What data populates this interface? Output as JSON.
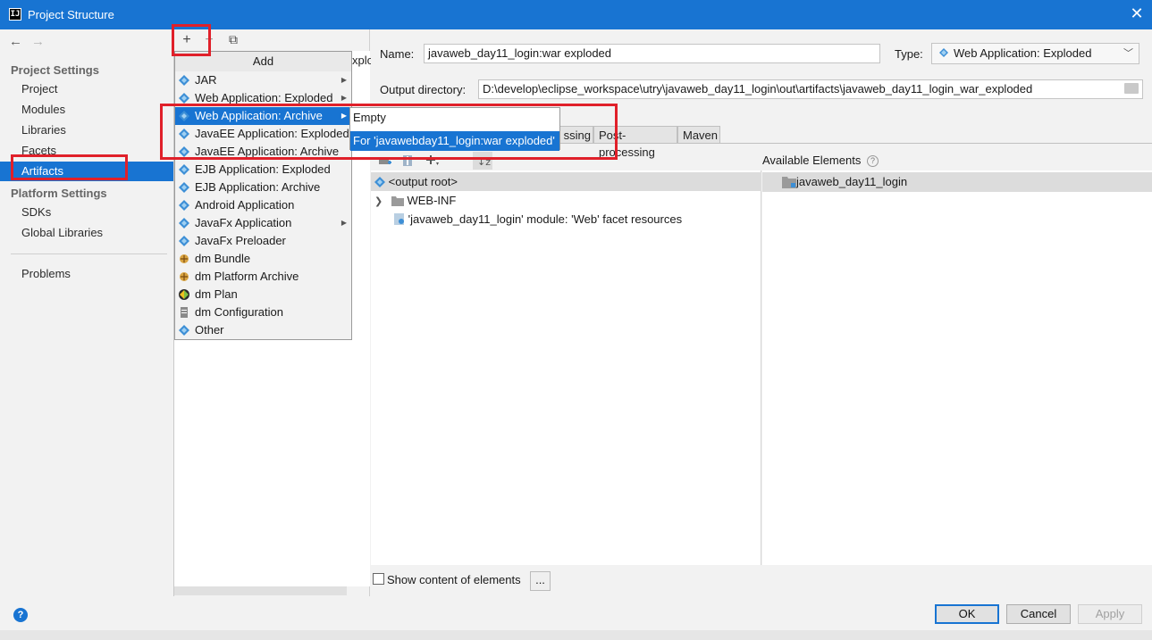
{
  "window": {
    "title": "Project Structure",
    "app_icon": "IJ"
  },
  "sidebar": {
    "project_settings_head": "Project Settings",
    "project_items": [
      "Project",
      "Modules",
      "Libraries",
      "Facets",
      "Artifacts"
    ],
    "platform_settings_head": "Platform Settings",
    "platform_items": [
      "SDKs",
      "Global Libraries"
    ],
    "problems": "Problems",
    "selected": "Artifacts"
  },
  "mid_toolbar": {
    "add": "+",
    "remove": "−",
    "copy": "⧉"
  },
  "popup": {
    "title": "Add",
    "items": [
      {
        "label": "JAR",
        "submenu": true
      },
      {
        "label": "Web Application: Exploded",
        "submenu": true
      },
      {
        "label": "Web Application: Archive",
        "submenu": true,
        "active": true
      },
      {
        "label": "JavaEE Application: Exploded",
        "submenu": false
      },
      {
        "label": "JavaEE Application: Archive",
        "submenu": false
      },
      {
        "label": "EJB Application: Exploded",
        "submenu": false
      },
      {
        "label": "EJB Application: Archive",
        "submenu": false
      },
      {
        "label": "Android Application",
        "submenu": false
      },
      {
        "label": "JavaFx Application",
        "submenu": true
      },
      {
        "label": "JavaFx Preloader",
        "submenu": false
      },
      {
        "label": "dm Bundle",
        "submenu": false
      },
      {
        "label": "dm Platform Archive",
        "submenu": false
      },
      {
        "label": "dm Plan",
        "submenu": false
      },
      {
        "label": "dm Configuration",
        "submenu": false
      },
      {
        "label": "Other",
        "submenu": false
      }
    ]
  },
  "submenu": {
    "items": [
      "Empty",
      "For 'javawebday11_login:war exploded'"
    ]
  },
  "behind_text": "xplo",
  "editor": {
    "name_label": "Name:",
    "name_value": "javaweb_day11_login:war exploded",
    "type_label": "Type:",
    "type_value": "Web Application: Exploded",
    "output_label": "Output directory:",
    "output_value": "D:\\develop\\eclipse_workspace\\utry\\javaweb_day11_login\\out\\artifacts\\javaweb_day11_login_war_exploded",
    "tabs": [
      "ssing",
      "Post-processing",
      "Maven"
    ],
    "tree": [
      {
        "label": "<output root>"
      },
      {
        "label": "WEB-INF"
      },
      {
        "label": "'javaweb_day11_login' module: 'Web' facet resources"
      }
    ],
    "available_head": "Available Elements",
    "available_items": [
      "javaweb_day11_login"
    ],
    "show_content_label": "Show content of elements",
    "dots": "..."
  },
  "buttons": {
    "ok": "OK",
    "cancel": "Cancel",
    "apply": "Apply"
  },
  "colors": {
    "accent": "#1874d2",
    "highlight": "#e0202a"
  }
}
